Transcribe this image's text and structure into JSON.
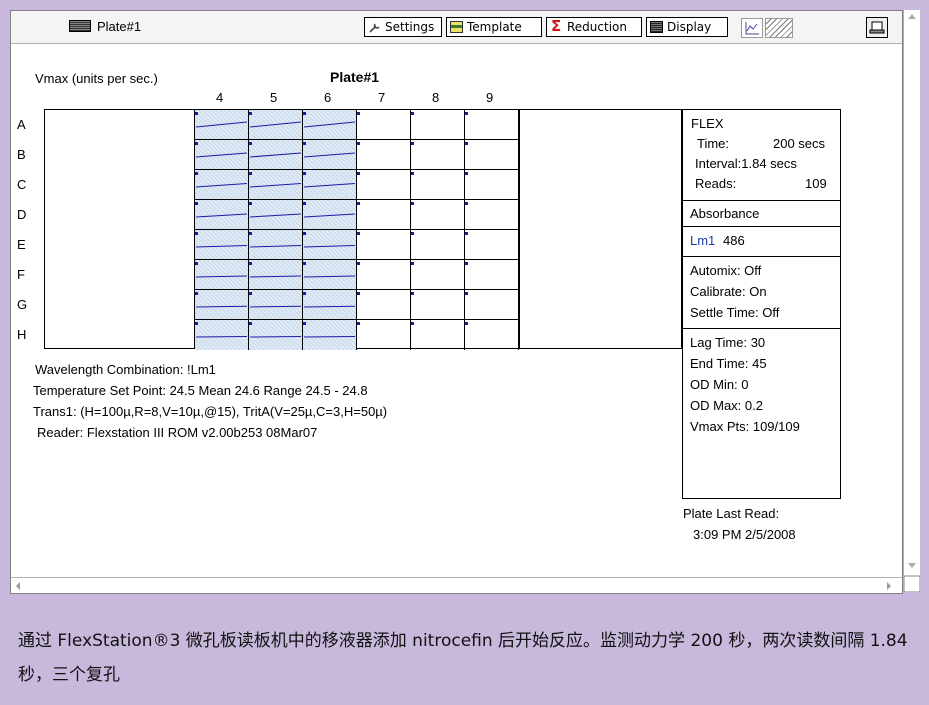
{
  "window": {
    "title": "Plate#1"
  },
  "toolbar": {
    "settings": "Settings",
    "template": "Template",
    "reduction": "Reduction",
    "display": "Display"
  },
  "report": {
    "vmax_label": "Vmax (units per sec.)",
    "plate_title": "Plate#1",
    "columns": [
      "4",
      "5",
      "6",
      "7",
      "8",
      "9"
    ],
    "rows": [
      "A",
      "B",
      "C",
      "D",
      "E",
      "F",
      "G",
      "H"
    ],
    "active_columns": [
      "4",
      "5",
      "6"
    ],
    "footer": [
      "Wavelength Combination: !Lm1",
      "Temperature Set Point: 24.5  Mean 24.6  Range 24.5 - 24.8",
      "Trans1: (H=100µ,R=8,V=10µ,@15), TritA(V=25µ,C=3,H=50µ)",
      "Reader: Flexstation III ROM v2.00b253 08Mar07"
    ]
  },
  "info_panel": {
    "mode": "FLEX",
    "time_label": "Time:",
    "time_value": "200 secs",
    "interval": "Interval:1.84 secs",
    "reads_label": "Reads:",
    "reads_value": "109",
    "read_type": "Absorbance",
    "lm_label": "Lm1",
    "lm_value": "486",
    "automix": "Automix: Off",
    "calibrate": "Calibrate: On",
    "settle": "Settle Time: Off",
    "lag": "Lag Time: 30",
    "end": "End Time: 45",
    "od_min": "OD Min: 0",
    "od_max": "OD Max: 0.2",
    "vmax_pts": "Vmax Pts: 109/109"
  },
  "last_read": {
    "label": "Plate Last Read:",
    "value": "3:09 PM  2/5/2008"
  },
  "caption": "通过 FlexStation®3 微孔板读板机中的移液器添加 nitrocefin 后开始反应。监测动力学 200 秒，两次读数间隔 1.84 秒，三个复孔",
  "colors": {
    "accent_trace": "#1a1aa8",
    "background": "#c8b8dc",
    "active_well": "#cfdeef",
    "lm_label": "#1a3aa8"
  }
}
